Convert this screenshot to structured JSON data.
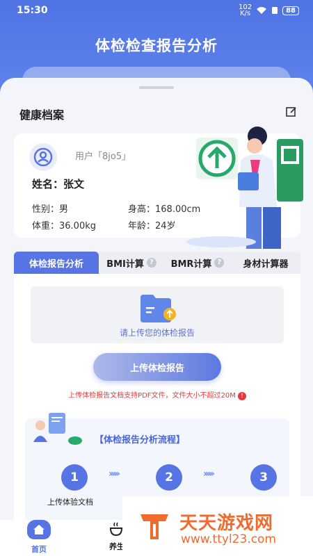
{
  "status": {
    "time": "15:30",
    "net_speed_top": "102",
    "net_speed_bottom": "K/s",
    "battery": "88"
  },
  "app": {
    "title": "体检检查报告分析"
  },
  "health": {
    "section_title": "健康档案",
    "user_label": "用户「8jo5」",
    "name_label": "姓名：张文",
    "gender": "性别：男",
    "height": "身高：168.00cm",
    "weight": "体重：36.00kg",
    "age": "年龄：24岁"
  },
  "tabs": [
    {
      "label": "体检报告分析",
      "active": true
    },
    {
      "label": "BMI计算",
      "help": "?"
    },
    {
      "label": "BMR计算",
      "help": "?"
    },
    {
      "label": "身材计算器"
    }
  ],
  "upload": {
    "hint": "请上传您的体检报告",
    "button": "上传体检报告",
    "note": "上传体检报告文档支持PDF文件，文件大小不超过20M",
    "note_icon": "!"
  },
  "flow": {
    "title": "【体检报告分析流程】",
    "steps": [
      "1",
      "2",
      "3"
    ],
    "arrows": "›››››",
    "step1_label": "上传体验文档"
  },
  "nav": {
    "home": "首页",
    "health": "养生"
  },
  "watermark": {
    "brand": "天天游戏网",
    "url": "www.ttyl23.com"
  },
  "colors": {
    "primary": "#5674e4",
    "header": "#4f73e3",
    "warning": "#e23b3b",
    "watermark": "#ef6b2e"
  }
}
